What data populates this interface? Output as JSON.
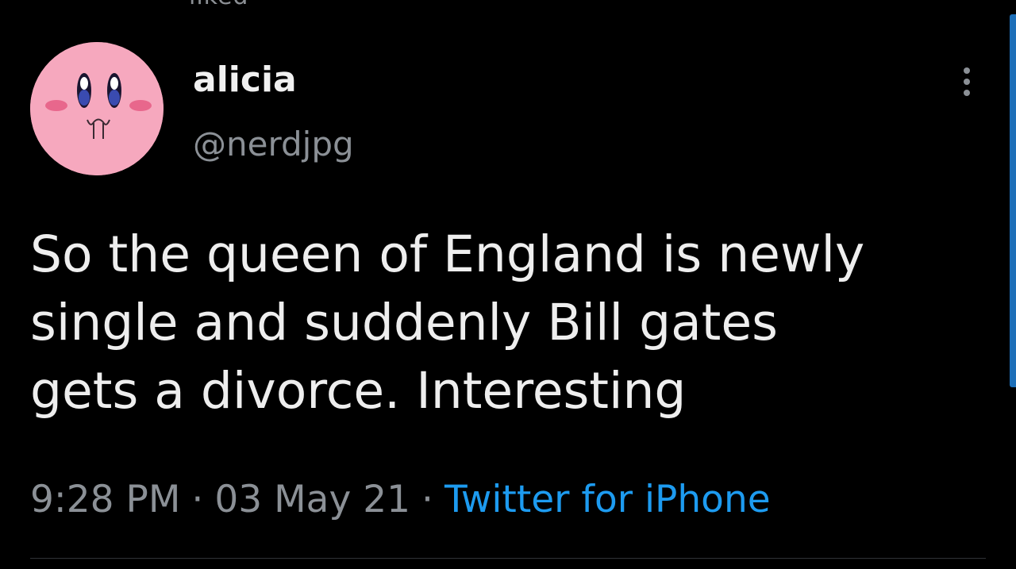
{
  "top_context": "liked",
  "user": {
    "display_name": "alicia",
    "handle": "@nerdjpg",
    "avatar_icon": "kirby-face-avatar"
  },
  "tweet": {
    "text": "So the queen of England is newly\nsingle and suddenly Bill gates\ngets a divorce. Interesting",
    "time": "9:28 PM",
    "date": "03 May 21",
    "separator": "·",
    "source": "Twitter for iPhone"
  },
  "colors": {
    "background": "#000000",
    "text_primary": "#eeeeee",
    "text_secondary": "#8b9096",
    "link": "#1d9bf0",
    "avatar_pink": "#f6a8be"
  }
}
